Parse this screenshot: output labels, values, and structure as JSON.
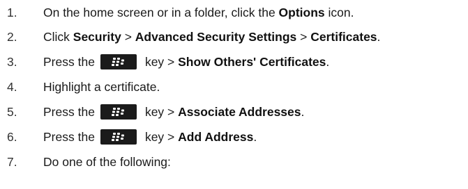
{
  "steps": [
    {
      "number": "1.",
      "parts": [
        {
          "text": "On the home screen or in a folder, click the "
        },
        {
          "text": "Options",
          "bold": true
        },
        {
          "text": " icon."
        }
      ]
    },
    {
      "number": "2.",
      "parts": [
        {
          "text": "Click "
        },
        {
          "text": "Security",
          "bold": true
        },
        {
          "text": " > "
        },
        {
          "text": "Advanced Security Settings",
          "bold": true
        },
        {
          "text": " > "
        },
        {
          "text": "Certificates",
          "bold": true
        },
        {
          "text": "."
        }
      ]
    },
    {
      "number": "3.",
      "parts": [
        {
          "text": "Press the"
        },
        {
          "icon": "blackberry-menu-key-icon"
        },
        {
          "text": "key > "
        },
        {
          "text": "Show Others' Certificates",
          "bold": true
        },
        {
          "text": "."
        }
      ]
    },
    {
      "number": "4.",
      "parts": [
        {
          "text": "Highlight a certificate."
        }
      ]
    },
    {
      "number": "5.",
      "parts": [
        {
          "text": "Press the"
        },
        {
          "icon": "blackberry-menu-key-icon"
        },
        {
          "text": "key > "
        },
        {
          "text": "Associate Addresses",
          "bold": true
        },
        {
          "text": "."
        }
      ]
    },
    {
      "number": "6.",
      "parts": [
        {
          "text": "Press the"
        },
        {
          "icon": "blackberry-menu-key-icon"
        },
        {
          "text": "key > "
        },
        {
          "text": "Add Address",
          "bold": true
        },
        {
          "text": "."
        }
      ]
    },
    {
      "number": "7.",
      "parts": [
        {
          "text": "Do one of the following:"
        }
      ]
    }
  ],
  "colors": {
    "key_background": "#1b1b1b",
    "key_glyph": "#ffffff"
  }
}
